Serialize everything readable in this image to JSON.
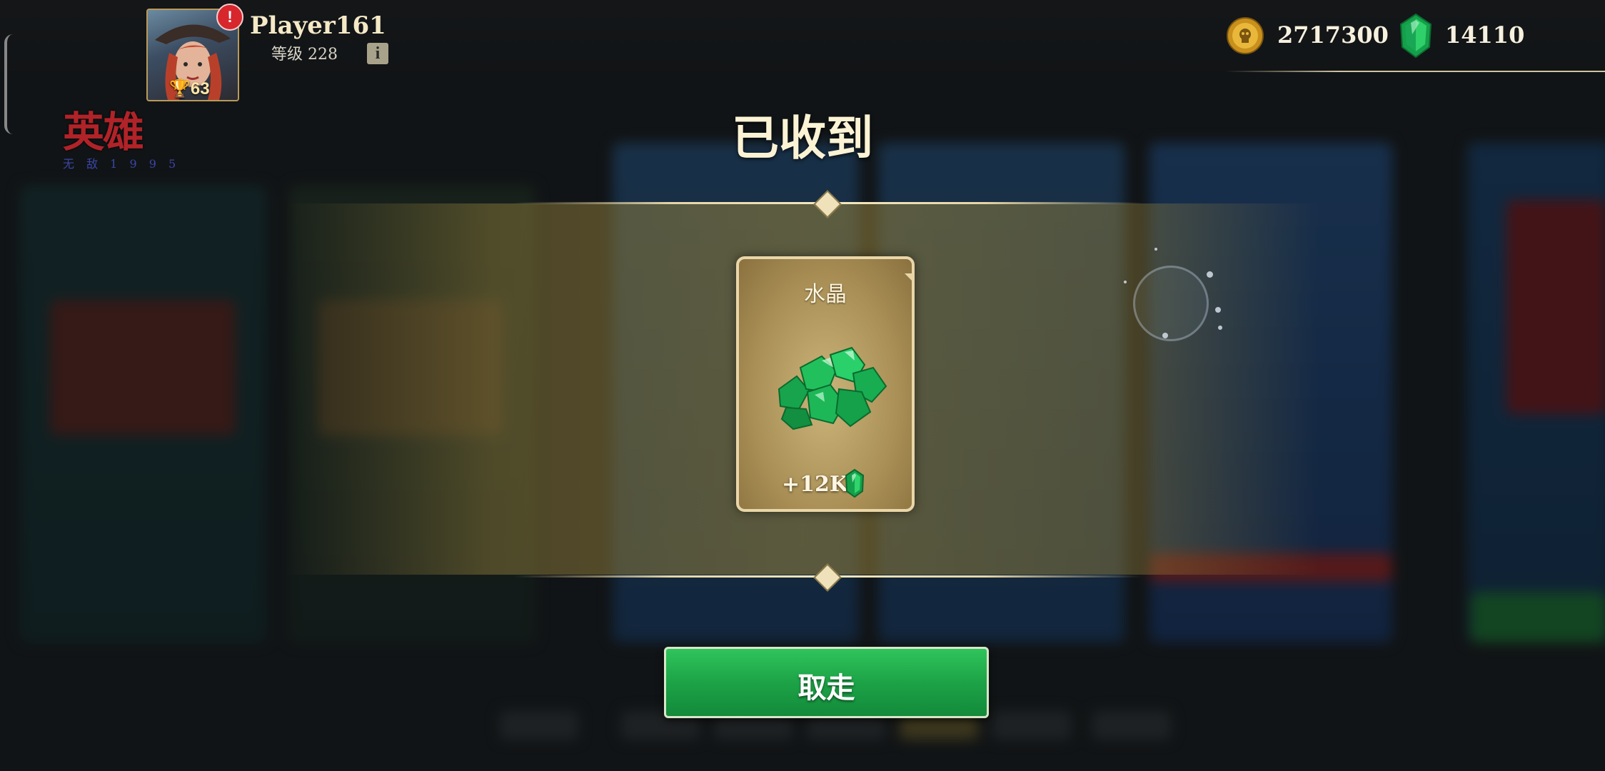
{
  "player": {
    "name": "Player161",
    "level_text": "等级 228",
    "trophies": "63",
    "alert_badge": "!",
    "info_icon": "i"
  },
  "currencies": {
    "coins": "2717300",
    "gems": "14110"
  },
  "brand": {
    "logo_text": "英雄",
    "logo_subtext": "无 敌 1 9 9 5"
  },
  "modal": {
    "title": "已收到",
    "reward": {
      "name": "水晶",
      "amount": "+12K",
      "icon": "gem-icon"
    },
    "take_button": "取走"
  },
  "colors": {
    "gem": "#1fbf5a",
    "button_green": "#1da347",
    "gold_frame": "#e9d6a8",
    "title": "#fbf3d4"
  }
}
